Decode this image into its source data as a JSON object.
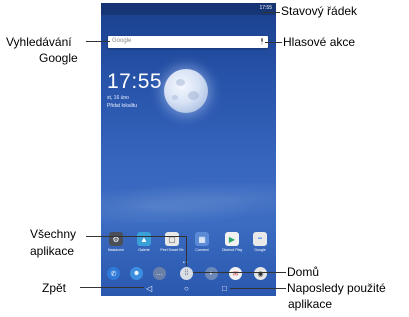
{
  "annotations": {
    "status_bar": "Stavový řádek",
    "google_search_line1": "Vyhledávání",
    "google_search_line2": "Google",
    "voice_actions": "Hlasové akce",
    "all_apps_line1": "Všechny",
    "all_apps_line2": "aplikace",
    "home": "Domů",
    "back": "Zpět",
    "recent_apps_line1": "Naposledy použité",
    "recent_apps_line2": "aplikace"
  },
  "screen": {
    "status_time": "17:55",
    "search_placeholder": "Google",
    "clock": "17:55",
    "date": "st, 16 úno",
    "location": "Přidat lokalitu",
    "apps": [
      {
        "label": "Nastavení",
        "icon": "gear-icon",
        "color": "#4a4f5a"
      },
      {
        "label": "Galerie",
        "icon": "gallery-icon",
        "color": "#3aa0d8"
      },
      {
        "label": "Peel Smart Re",
        "icon": "remote-icon",
        "color": "#e8e8e8"
      },
      {
        "label": "Connect",
        "icon": "connect-icon",
        "color": "#5b8bd6"
      },
      {
        "label": "Obchod Play",
        "icon": "play-store-icon",
        "color": "#f1f1f1"
      },
      {
        "label": "Google",
        "icon": "google-folder-icon",
        "color": "#e9e9e9"
      }
    ],
    "dock": [
      {
        "icon": "phone-icon",
        "color": "#2f7ad8"
      },
      {
        "icon": "contacts-icon",
        "color": "#3e8ee0"
      },
      {
        "icon": "messages-icon",
        "color": "#6a7fa8"
      },
      {
        "icon": "all-apps-icon",
        "color": "#d9dde6"
      },
      {
        "icon": "browser-icon",
        "color": "#6b88b8"
      },
      {
        "icon": "email-icon",
        "color": "#f1f1f1"
      },
      {
        "icon": "camera-icon",
        "color": "#e6e6e6"
      }
    ]
  }
}
